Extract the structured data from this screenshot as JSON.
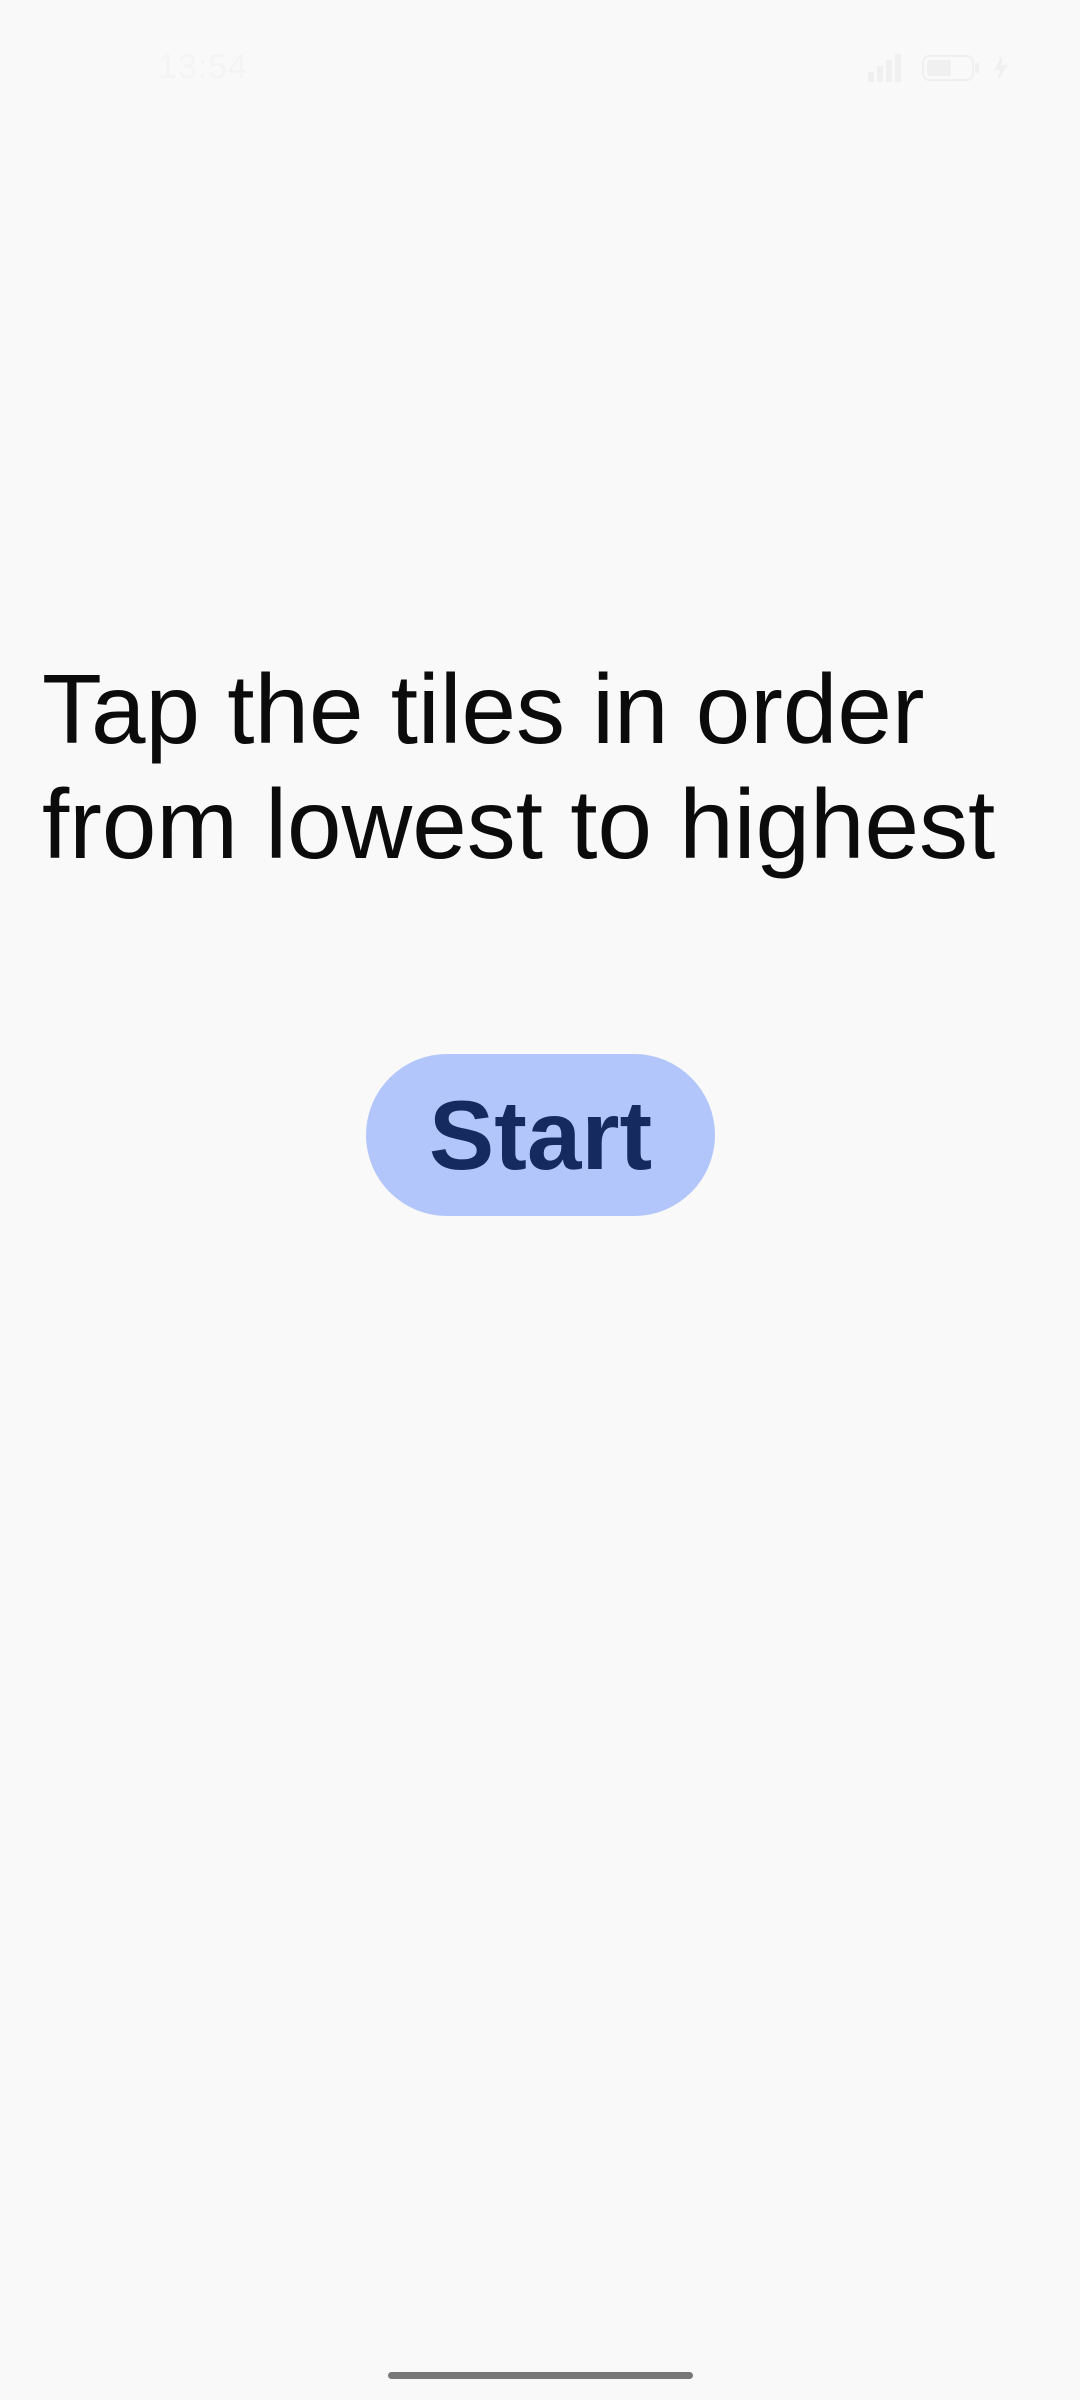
{
  "status_bar": {
    "time": "13:54",
    "icons": [
      "signal-icon",
      "battery-icon",
      "charging-icon"
    ]
  },
  "main": {
    "instruction": "Tap the tiles in order from lowest to highest",
    "start_label": "Start"
  },
  "colors": {
    "background": "#f9f9f9",
    "button_bg": "#b3c6fb",
    "button_text": "#152a5e",
    "text": "#0b0b0b"
  }
}
